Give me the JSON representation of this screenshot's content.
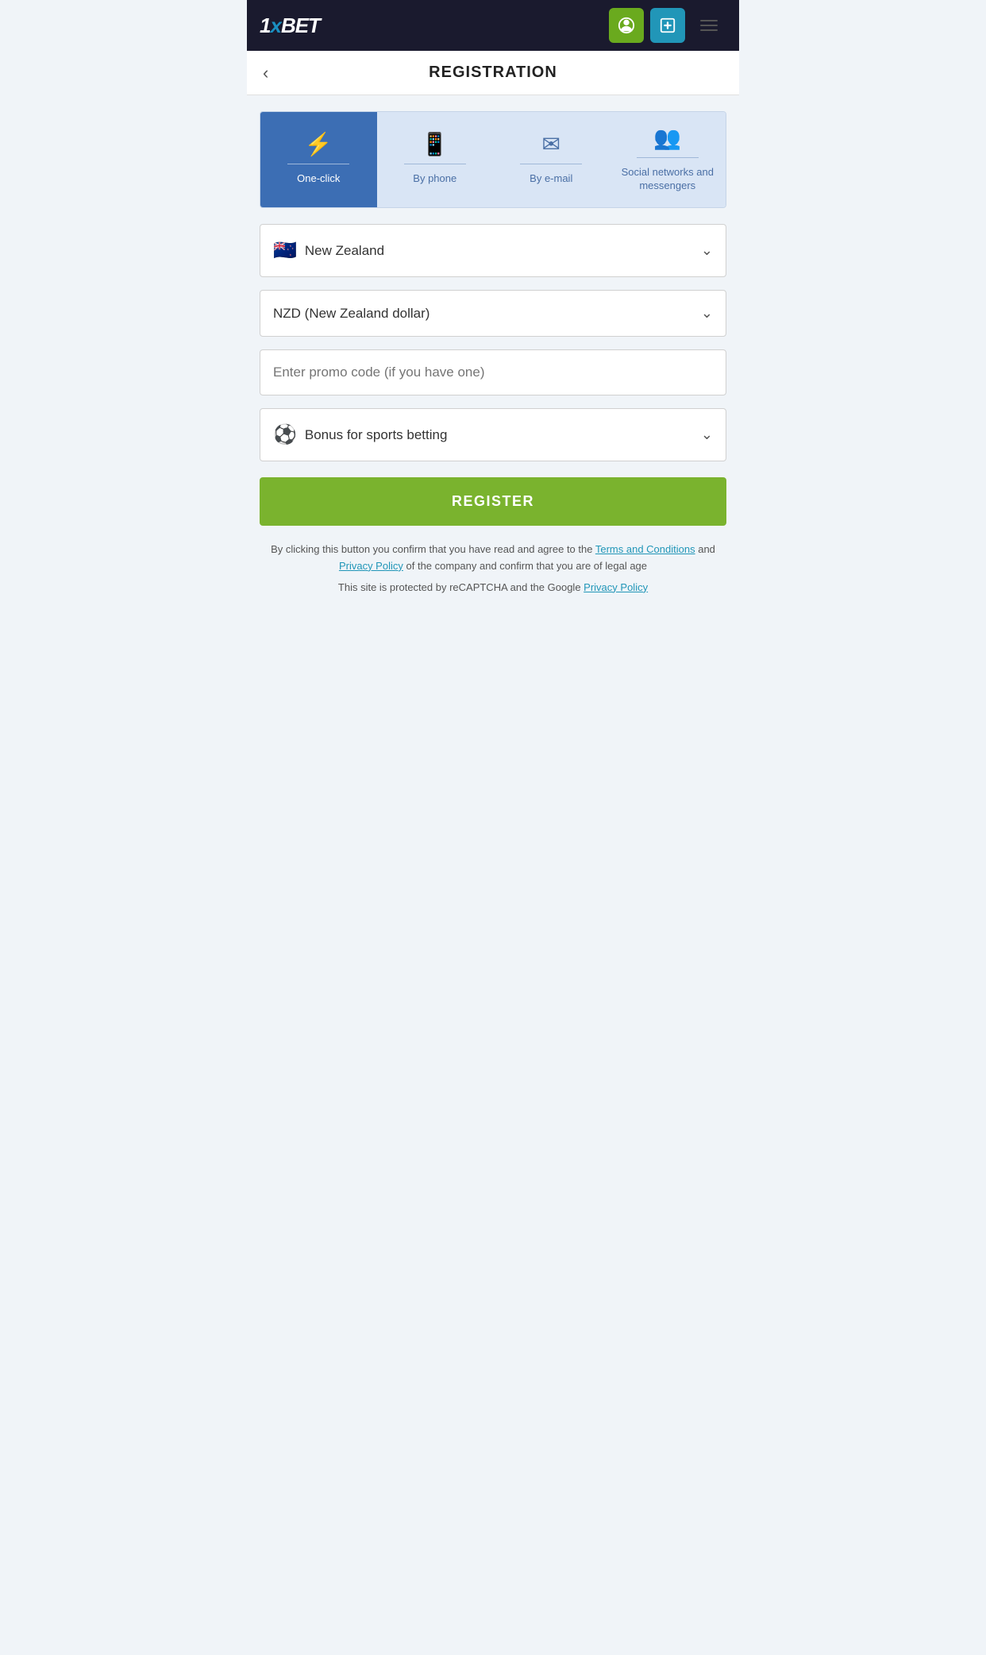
{
  "header": {
    "logo": "1xBET",
    "login_icon_label": "login",
    "deposit_icon_label": "deposit",
    "menu_icon_label": "menu"
  },
  "page": {
    "title": "REGISTRATION",
    "back_label": "back"
  },
  "tabs": [
    {
      "id": "one-click",
      "label": "One-click",
      "icon": "⚡",
      "active": true
    },
    {
      "id": "by-phone",
      "label": "By phone",
      "icon": "📱",
      "active": false
    },
    {
      "id": "by-email",
      "label": "By e-mail",
      "icon": "✉",
      "active": false
    },
    {
      "id": "social",
      "label": "Social networks and messengers",
      "icon": "👥",
      "active": false
    }
  ],
  "form": {
    "country": {
      "flag": "🇳🇿",
      "value": "New Zealand"
    },
    "currency": {
      "value": "NZD (New Zealand dollar)"
    },
    "promo": {
      "placeholder": "Enter promo code (if you have one)"
    },
    "bonus": {
      "icon": "⚽",
      "value": "Bonus for sports betting"
    },
    "register_btn": "REGISTER"
  },
  "footer": {
    "text1": "By clicking this button you confirm that you have read and agree to the",
    "terms_label": "Terms and Conditions",
    "and": "and",
    "privacy_label": "Privacy Policy",
    "text2": "of the company and confirm that you are of legal age",
    "text3": "This site is protected by reCAPTCHA and the Google",
    "privacy_label2": "Privacy Policy"
  }
}
